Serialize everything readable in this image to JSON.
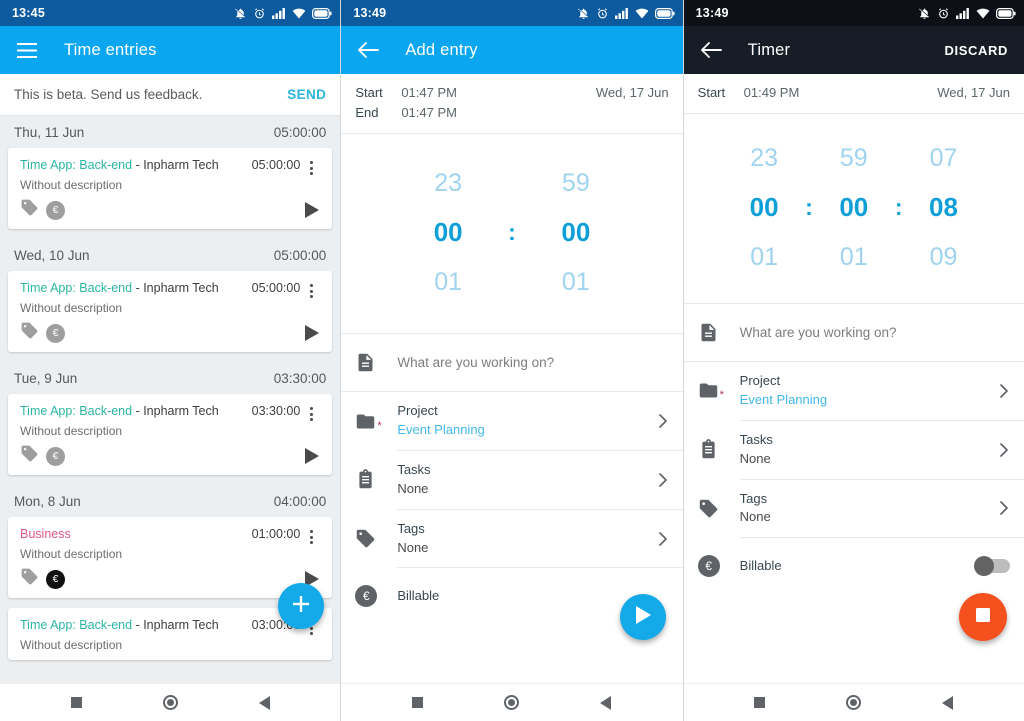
{
  "screens": {
    "list": {
      "status": {
        "clock": "13:45",
        "icons": [
          "bell-off-icon",
          "alarm-icon",
          "signal-icon",
          "wifi-icon",
          "battery-icon"
        ]
      },
      "appbar": {
        "menu_icon": "hamburger-menu-icon",
        "title": "Time entries"
      },
      "beta": {
        "text": "This is beta. Send us feedback.",
        "action": "SEND"
      },
      "groups": [
        {
          "date": "Thu, 11 Jun",
          "total": "05:00:00",
          "entries": [
            {
              "project": "Time App: Back-end",
              "client": " - Inpharm Tech",
              "project_color": "teal",
              "description": "Without description",
              "duration": "05:00:00",
              "billable_dark": false
            }
          ]
        },
        {
          "date": "Wed, 10 Jun",
          "total": "05:00:00",
          "entries": [
            {
              "project": "Time App: Back-end",
              "client": " - Inpharm Tech",
              "project_color": "teal",
              "description": "Without description",
              "duration": "05:00:00",
              "billable_dark": false
            }
          ]
        },
        {
          "date": "Tue, 9 Jun",
          "total": "03:30:00",
          "entries": [
            {
              "project": "Time App: Back-end",
              "client": " - Inpharm Tech",
              "project_color": "teal",
              "description": "Without description",
              "duration": "03:30:00",
              "billable_dark": false
            }
          ]
        },
        {
          "date": "Mon, 8 Jun",
          "total": "04:00:00",
          "entries": [
            {
              "project": "Business",
              "client": "",
              "project_color": "pink",
              "description": "Without description",
              "duration": "01:00:00",
              "billable_dark": true
            },
            {
              "project": "Time App: Back-end",
              "client": " - Inpharm Tech",
              "project_color": "teal",
              "description": "Without description",
              "duration": "03:00:00",
              "billable_dark": false
            }
          ]
        }
      ],
      "fab": {
        "icon": "plus-icon"
      }
    },
    "add_entry": {
      "status": {
        "clock": "13:49"
      },
      "appbar": {
        "back_icon": "back-arrow-icon",
        "title": "Add entry"
      },
      "summary": {
        "start_label": "Start",
        "start_value": "01:47 PM",
        "end_label": "End",
        "end_value": "01:47 PM",
        "date": "Wed, 17 Jun"
      },
      "picker": {
        "columns": [
          {
            "above": "23",
            "selected": "00",
            "below": "01"
          },
          {
            "above": "59",
            "selected": "00",
            "below": "01"
          }
        ],
        "separator": ":"
      },
      "note": {
        "icon": "document-icon",
        "placeholder": "What are you working on?"
      },
      "rows": [
        {
          "icon": "folder-icon",
          "label": "Project",
          "value": "Event Planning",
          "required": true,
          "link": true,
          "chevron": "chevron-right-icon"
        },
        {
          "icon": "clipboard-icon",
          "label": "Tasks",
          "value": "None",
          "required": false,
          "link": false,
          "chevron": "chevron-right-icon"
        },
        {
          "icon": "tag-icon",
          "label": "Tags",
          "value": "None",
          "required": false,
          "link": false,
          "chevron": "chevron-right-icon"
        },
        {
          "icon": "euro-icon",
          "label": "Billable",
          "value": "",
          "required": false,
          "link": false,
          "chevron": ""
        }
      ],
      "fab": {
        "icon": "play-icon"
      }
    },
    "timer": {
      "status": {
        "clock": "13:49"
      },
      "appbar": {
        "back_icon": "back-arrow-icon",
        "title": "Timer",
        "action": "DISCARD"
      },
      "summary": {
        "start_label": "Start",
        "start_value": "01:49 PM",
        "date": "Wed, 17 Jun"
      },
      "picker": {
        "columns": [
          {
            "above": "23",
            "selected": "00",
            "below": "01"
          },
          {
            "above": "59",
            "selected": "00",
            "below": "01"
          },
          {
            "above": "07",
            "selected": "08",
            "below": "09"
          }
        ],
        "separator": ":"
      },
      "note": {
        "icon": "document-icon",
        "placeholder": "What are you working on?"
      },
      "rows": [
        {
          "icon": "folder-icon",
          "label": "Project",
          "value": "Event Planning",
          "required": true,
          "link": true,
          "chevron": "chevron-right-icon"
        },
        {
          "icon": "clipboard-icon",
          "label": "Tasks",
          "value": "None",
          "required": false,
          "link": false,
          "chevron": "chevron-right-icon"
        },
        {
          "icon": "tag-icon",
          "label": "Tags",
          "value": "None",
          "required": false,
          "link": false,
          "chevron": "chevron-right-icon"
        },
        {
          "icon": "euro-icon",
          "label": "Billable",
          "value": "",
          "required": false,
          "link": false,
          "chevron": ""
        }
      ],
      "billable_toggle": {
        "on": false
      },
      "fab": {
        "icon": "stop-icon"
      }
    }
  },
  "navbar": {
    "recents": "square-icon",
    "home": "circle-icon",
    "back": "triangle-back-icon"
  },
  "colors": {
    "status_blue": "#0d5a9e",
    "appbar_blue": "#0aa6f0",
    "appbar_dark": "#161d27",
    "accent_teal": "#2bb5a3",
    "accent_pink": "#e0558a",
    "link_blue": "#3fb8e8",
    "picker_selected": "#0f9fd8",
    "picker_dim": "#9fd3ef",
    "fab_blue": "#14a9e8",
    "fab_orange": "#f4511e",
    "list_bg": "#eceff1"
  }
}
